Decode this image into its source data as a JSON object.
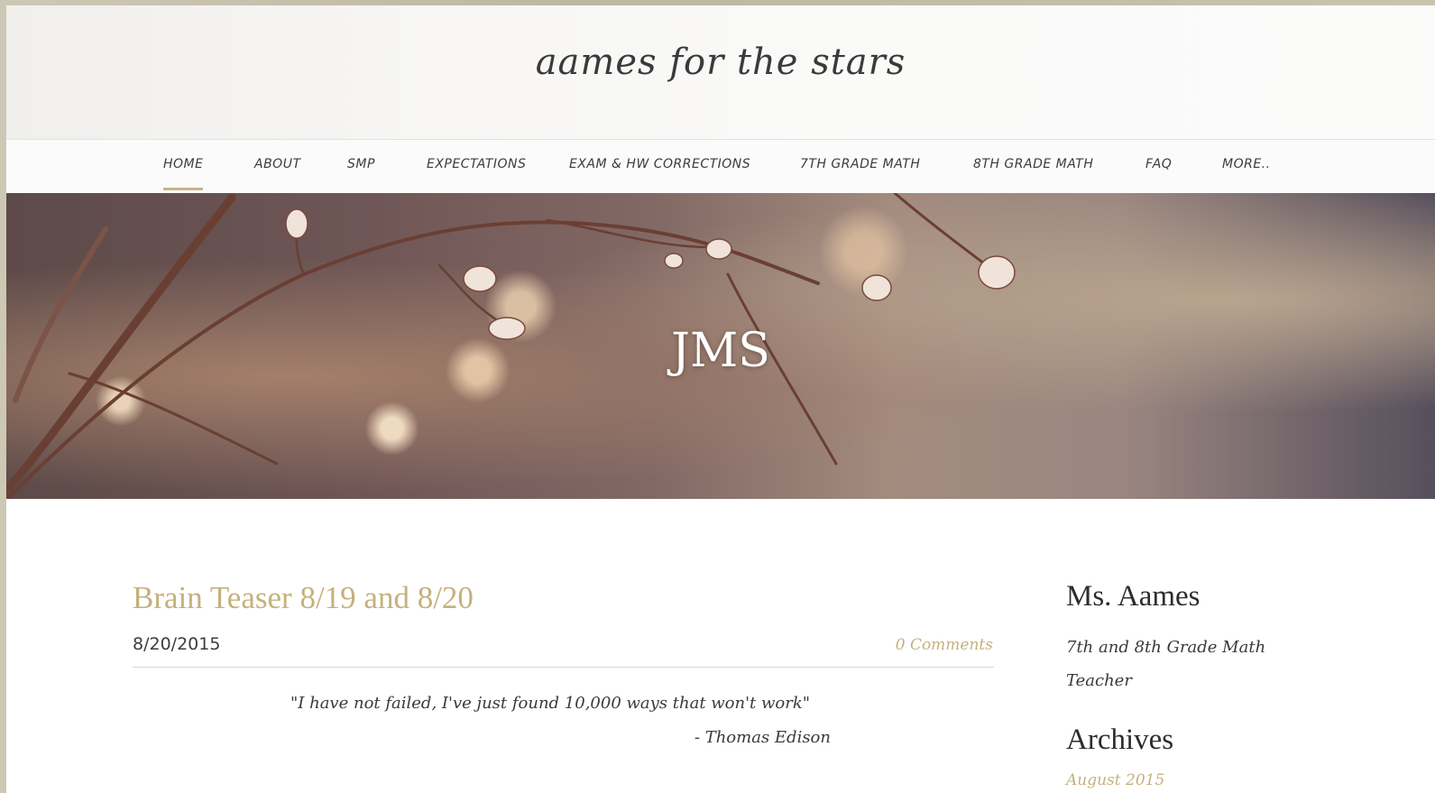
{
  "site": {
    "title": "aames for the stars"
  },
  "nav": {
    "items": [
      {
        "label": "HOME",
        "active": true
      },
      {
        "label": "ABOUT"
      },
      {
        "label": "SMP"
      },
      {
        "label": "EXPECTATIONS"
      },
      {
        "label": "EXAM & HW CORRECTIONS"
      },
      {
        "label": "7TH GRADE MATH"
      },
      {
        "label": "8TH GRADE MATH"
      },
      {
        "label": "FAQ"
      },
      {
        "label": "MORE.."
      }
    ]
  },
  "banner": {
    "title": "JMS"
  },
  "post": {
    "title": "Brain Teaser 8/19 and 8/20",
    "date": "8/20/2015",
    "comments": "0 Comments",
    "quote": "\"I have not failed, I've just found 10,000 ways that won't work\"",
    "quote_author": "- Thomas Edison"
  },
  "sidebar": {
    "name": "Ms. Aames",
    "description": "7th and 8th Grade Math Teacher",
    "archives_title": "Archives",
    "archives": [
      "August 2015"
    ]
  },
  "colors": {
    "accent": "#c5b17c",
    "text": "#3a3a3a",
    "nav_underline": "#c9b48a"
  }
}
